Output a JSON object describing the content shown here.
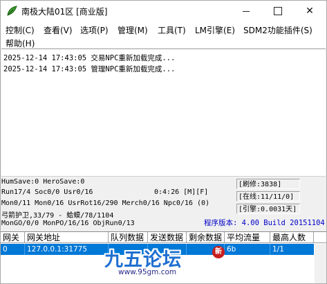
{
  "window": {
    "title": "南极大陆01区 [商业版]",
    "controls": {
      "minimize": "—",
      "maximize": "☐",
      "close": "✕"
    }
  },
  "menu": {
    "items": [
      "控制(C)",
      "查看(V)",
      "选项(P)",
      "管理(M)",
      "工具(T)",
      "LM引擎(E)",
      "SDM2功能插件(S)",
      "帮助(H)"
    ]
  },
  "log": {
    "lines": [
      "2025-12-14 17:43:05 交易NPC重新加载完成...",
      "2025-12-14 17:43:05 管理NPC重新加载完成..."
    ]
  },
  "status": {
    "hum_save": "HumSave:0 HeroSave:0",
    "run": "Run17/4 Soc0/0 Usr0/16",
    "time": "0:4:26 [M][F]",
    "mon": "Mon0/11 Mon0/16 UsrRot16/290 Merch0/16 Npc0/16 (0)",
    "guard": "弓箭护卫,33/79 - 蛤蟆/78/1104",
    "mongo": "MonGO/0/0 MonPO/16/16 ObjRun0/13",
    "refresh": "[刷修:3838]",
    "online": "[在线:11/11/0]",
    "engine": "[引擎:0.0031天]",
    "version": "程序版本: 4.00 Build 20151104"
  },
  "table": {
    "headers": [
      "网关",
      "网关地址",
      "队列数据",
      "发送数据",
      "剩余数据",
      "平均流量",
      "最高人数"
    ],
    "rows": [
      [
        "0",
        "127.0.0.1:31775",
        "",
        "",
        "",
        "6b",
        "1/1"
      ]
    ]
  },
  "watermark": {
    "logo_text": "九五论坛",
    "url": "www.95gm.com",
    "badge": "新"
  },
  "colors": {
    "selection": "#0078d7",
    "version_text": "#0000c8",
    "watermark_blue": "#1f6fd0"
  }
}
